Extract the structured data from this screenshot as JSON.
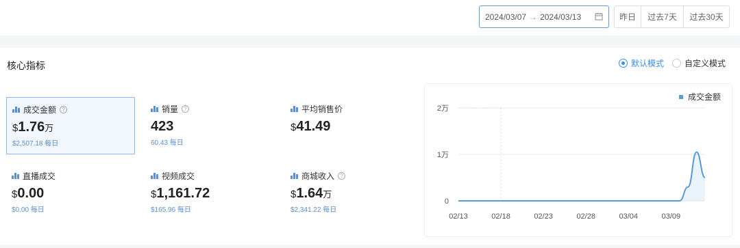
{
  "toolbar": {
    "date_start": "2024/03/07",
    "date_arrow": "→",
    "date_end": "2024/03/13",
    "quick_yesterday": "昨日",
    "quick_7d": "过去7天",
    "quick_30d": "过去30天"
  },
  "panel": {
    "title": "核心指标",
    "mode_default": "默认模式",
    "mode_custom": "自定义模式"
  },
  "metrics": [
    {
      "label": "成交金额",
      "currency": "$",
      "value": "1.76",
      "unit": "万",
      "sub": "$2,507.18 每日",
      "help": "?"
    },
    {
      "label": "销量",
      "currency": "",
      "value": "423",
      "unit": "",
      "sub": "60.43 每日",
      "help": "?"
    },
    {
      "label": "平均销售价",
      "currency": "$",
      "value": "41.49",
      "unit": "",
      "sub": ""
    },
    {
      "label": "直播成交",
      "currency": "$",
      "value": "0.00",
      "unit": "",
      "sub": "$0.00 每日"
    },
    {
      "label": "视频成交",
      "currency": "$",
      "value": "1,161.72",
      "unit": "",
      "sub": "$165.96 每日"
    },
    {
      "label": "商城收入",
      "currency": "$",
      "value": "1.64",
      "unit": "万",
      "sub": "$2,341.22 每日",
      "help": "?"
    }
  ],
  "chart_data": {
    "type": "line",
    "legend": "成交金额",
    "legend_position": "top-right",
    "y_ticks": [
      "0",
      "1万",
      "2万"
    ],
    "ylim": [
      0,
      20000
    ],
    "x_ticks": [
      "02/13",
      "02/18",
      "02/23",
      "02/28",
      "03/04",
      "03/09"
    ],
    "series": [
      {
        "name": "成交金额",
        "color": "#5b9bd5",
        "x": [
          "02/13",
          "02/14",
          "02/15",
          "02/16",
          "02/17",
          "02/18",
          "02/19",
          "02/20",
          "02/21",
          "02/22",
          "02/23",
          "02/24",
          "02/25",
          "02/26",
          "02/27",
          "02/28",
          "02/29",
          "03/01",
          "03/02",
          "03/03",
          "03/04",
          "03/05",
          "03/06",
          "03/07",
          "03/08",
          "03/09",
          "03/10",
          "03/11",
          "03/12",
          "03/13"
        ],
        "values": [
          0,
          0,
          0,
          0,
          0,
          0,
          0,
          0,
          0,
          0,
          0,
          0,
          0,
          0,
          0,
          0,
          0,
          0,
          0,
          0,
          0,
          0,
          0,
          0,
          0,
          0,
          0,
          3000,
          10500,
          5000
        ]
      }
    ]
  }
}
